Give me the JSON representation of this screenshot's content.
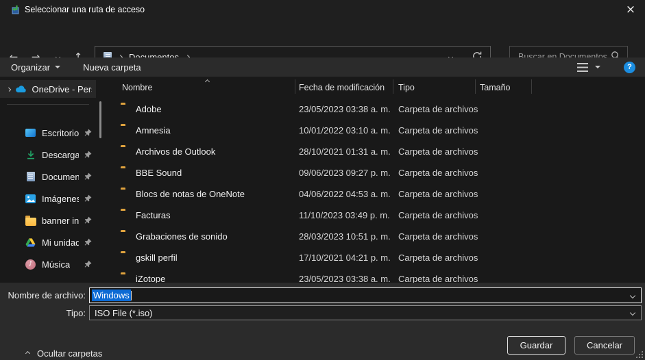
{
  "window": {
    "title": "Seleccionar una ruta de acceso",
    "close_glyph": "×"
  },
  "nav": {
    "back_glyph": "←",
    "forward_glyph": "→",
    "up_glyph": "↑",
    "location": "Documentos",
    "search_placeholder": "Buscar en Documentos"
  },
  "toolbar": {
    "organize": "Organizar",
    "new_folder": "Nueva carpeta",
    "help_glyph": "?"
  },
  "sidebar": {
    "onedrive_label": "OneDrive - Perso",
    "items": [
      {
        "label": "Escritorio",
        "icon": "desktop-icon"
      },
      {
        "label": "Descargas",
        "icon": "downloads-icon"
      },
      {
        "label": "Documentos",
        "icon": "documents-icon"
      },
      {
        "label": "Imágenes",
        "icon": "pictures-icon"
      },
      {
        "label": "banner inicio",
        "icon": "folder-icon"
      },
      {
        "label": "Mi unidad",
        "icon": "google-drive-icon"
      },
      {
        "label": "Música",
        "icon": "music-icon"
      }
    ],
    "music_glyph": "♪"
  },
  "list": {
    "columns": [
      "Nombre",
      "Fecha de modificación",
      "Tipo",
      "Tamaño"
    ],
    "rows": [
      {
        "name": "Adobe",
        "date": "23/05/2023 03:38 a. m.",
        "type": "Carpeta de archivos",
        "size": ""
      },
      {
        "name": "Amnesia",
        "date": "10/01/2022 03:10 a. m.",
        "type": "Carpeta de archivos",
        "size": ""
      },
      {
        "name": "Archivos de Outlook",
        "date": "28/10/2021 01:31 a. m.",
        "type": "Carpeta de archivos",
        "size": ""
      },
      {
        "name": "BBE Sound",
        "date": "09/06/2023 09:27 p. m.",
        "type": "Carpeta de archivos",
        "size": ""
      },
      {
        "name": "Blocs de notas de OneNote",
        "date": "04/06/2022 04:53 a. m.",
        "type": "Carpeta de archivos",
        "size": ""
      },
      {
        "name": "Facturas",
        "date": "11/10/2023 03:49 p. m.",
        "type": "Carpeta de archivos",
        "size": ""
      },
      {
        "name": "Grabaciones de sonido",
        "date": "28/03/2023 10:51 p. m.",
        "type": "Carpeta de archivos",
        "size": ""
      },
      {
        "name": "gskill perfil",
        "date": "17/10/2021 04:21 p. m.",
        "type": "Carpeta de archivos",
        "size": ""
      },
      {
        "name": "iZotope",
        "date": "23/05/2023 03:38 a. m.",
        "type": "Carpeta de archivos",
        "size": ""
      }
    ]
  },
  "form": {
    "filename_label": "Nombre de archivo:",
    "filename_value": "Windows",
    "type_label": "Tipo:",
    "type_value": "ISO File (*.iso)"
  },
  "footer": {
    "hide_folders": "Ocultar carpetas",
    "save": "Guardar",
    "cancel": "Cancelar"
  },
  "colors": {
    "selection": "#0c6ad4",
    "help_icon": "#1b8de0",
    "folder": "#fcb942",
    "download_green": "#21a366"
  }
}
